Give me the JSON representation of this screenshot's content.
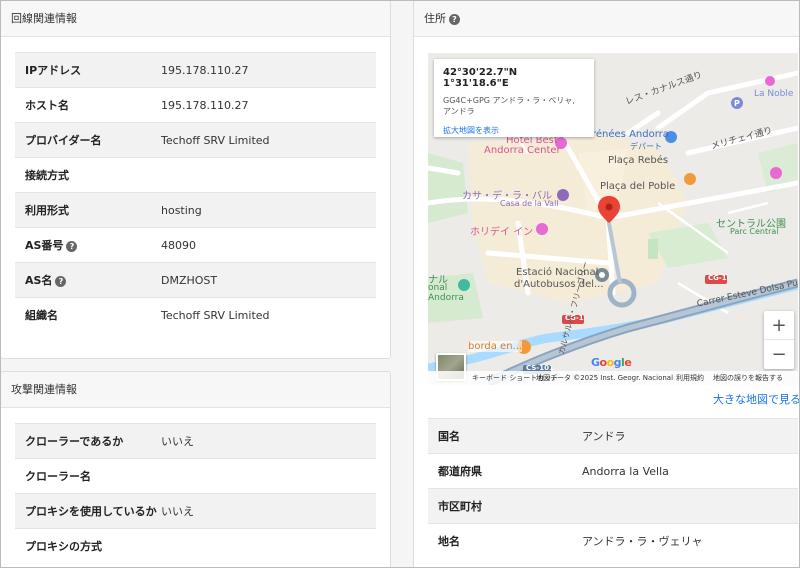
{
  "line_card": {
    "title": "回線関連情報",
    "rows": [
      {
        "key": "IPアドレス",
        "value": "195.178.110.27"
      },
      {
        "key": "ホスト名",
        "value": "195.178.110.27"
      },
      {
        "key": "プロバイダー名",
        "value": "Techoff SRV Limited"
      },
      {
        "key": "接続方式",
        "value": ""
      },
      {
        "key": "利用形式",
        "value": "hosting"
      },
      {
        "key": "AS番号",
        "value": "48090"
      },
      {
        "key": "AS名",
        "value": "DMZHOST"
      },
      {
        "key": "組織名",
        "value": "Techoff SRV Limited"
      }
    ]
  },
  "attack_card": {
    "title": "攻撃関連情報",
    "rows": [
      {
        "key": "クローラーであるか",
        "value": "いいえ"
      },
      {
        "key": "クローラー名",
        "value": ""
      },
      {
        "key": "プロキシを使用しているか",
        "value": "いいえ"
      },
      {
        "key": "プロキシの方式",
        "value": ""
      }
    ]
  },
  "address_card": {
    "title": "住所",
    "map": {
      "coords": "42°30'22.7\"N 1°31'18.6\"E",
      "plus_code": "GG4C+GPG アンドラ・ラ・ベリャ,",
      "plus_code_2": "アンドラ",
      "enlarge_link": "拡大地図を表示",
      "labels": {
        "lesCanals": "レス・カナルス通り",
        "laNoble": "La Noble",
        "hotelBest": "Hotel Best",
        "andorraCenter": "Andorra Center",
        "pyrenees": "rénées Andorra",
        "depart": "デパート",
        "meritxell": "メリチェイ通り",
        "placaRebes": "Plaça Rebés",
        "placaPoble": "Plaça del Poble",
        "casaVall": "カサ・デ・ラ・バル",
        "casaVallSub": "Casa de la Vall",
        "holiday": "ホリデイ イン",
        "parcCentral": "セントラル公園",
        "parcCentralSub": "Parc Central",
        "estacio1": "Estació Nacional",
        "estacio2": "d'Autobusos del...",
        "nal": "ナル",
        "nal2": "onal",
        "andorra": "Andorra",
        "cg1a": "CG-1",
        "cg1b": "CG-1",
        "cs101": "CS-101",
        "carrer": "Carrer Esteve Dolsa Pu",
        "bordaen": "borda en...",
        "carrerV": "カルサルバ・フリーゴリー"
      },
      "zoom_in": "+",
      "zoom_out": "−",
      "google": [
        "G",
        "o",
        "o",
        "g",
        "l",
        "e"
      ],
      "google_colors": [
        "#4285F4",
        "#EA4335",
        "#FBBC05",
        "#4285F4",
        "#34A853",
        "#EA4335"
      ],
      "footer": {
        "shortcuts": "キーボード ショートカット",
        "mapdata": "地図データ ©2025 Inst. Geogr. Nacional",
        "terms": "利用規約",
        "report": "地図の誤りを報告する"
      }
    },
    "big_map_link": "大きな地図で見る",
    "rows": [
      {
        "key": "国名",
        "value": "アンドラ"
      },
      {
        "key": "都道府県",
        "value": "Andorra la Vella"
      },
      {
        "key": "市区町村",
        "value": ""
      },
      {
        "key": "地名",
        "value": "アンドラ・ラ・ヴェリャ"
      }
    ]
  }
}
